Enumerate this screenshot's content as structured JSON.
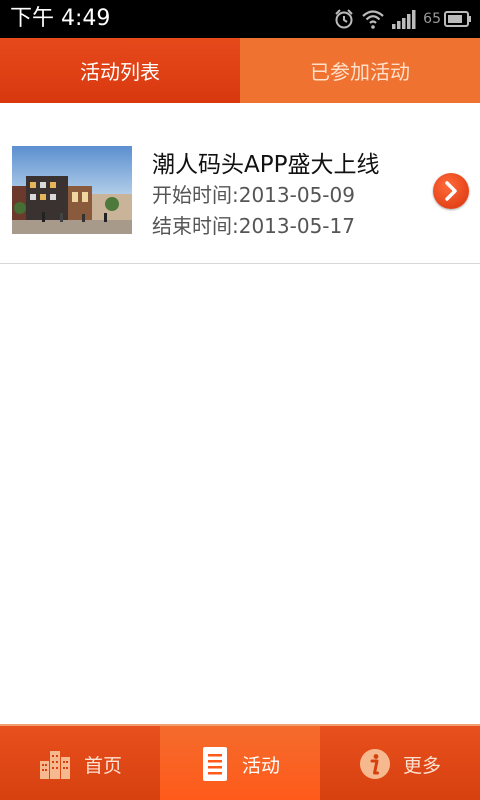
{
  "status_bar": {
    "time": "下午 4:49",
    "battery": "65",
    "icons": [
      "alarm-icon",
      "wifi-icon",
      "signal-icon",
      "battery-icon"
    ]
  },
  "tabs": [
    {
      "label": "活动列表",
      "active": true
    },
    {
      "label": "已参加活动",
      "active": false
    }
  ],
  "activities": [
    {
      "title": "潮人码头APP盛大上线",
      "start": "开始时间:2013-05-09",
      "end": "结束时间:2013-05-17",
      "icon": "chevron-right-icon"
    }
  ],
  "bottom_nav": [
    {
      "label": "首页",
      "icon": "buildings-icon",
      "active": false
    },
    {
      "label": "活动",
      "icon": "document-icon",
      "active": true
    },
    {
      "label": "更多",
      "icon": "info-icon",
      "active": false
    }
  ],
  "colors": {
    "accent": "#d9380f",
    "tab_inactive": "#ef7230",
    "nav_active": "#ff5a1a"
  }
}
